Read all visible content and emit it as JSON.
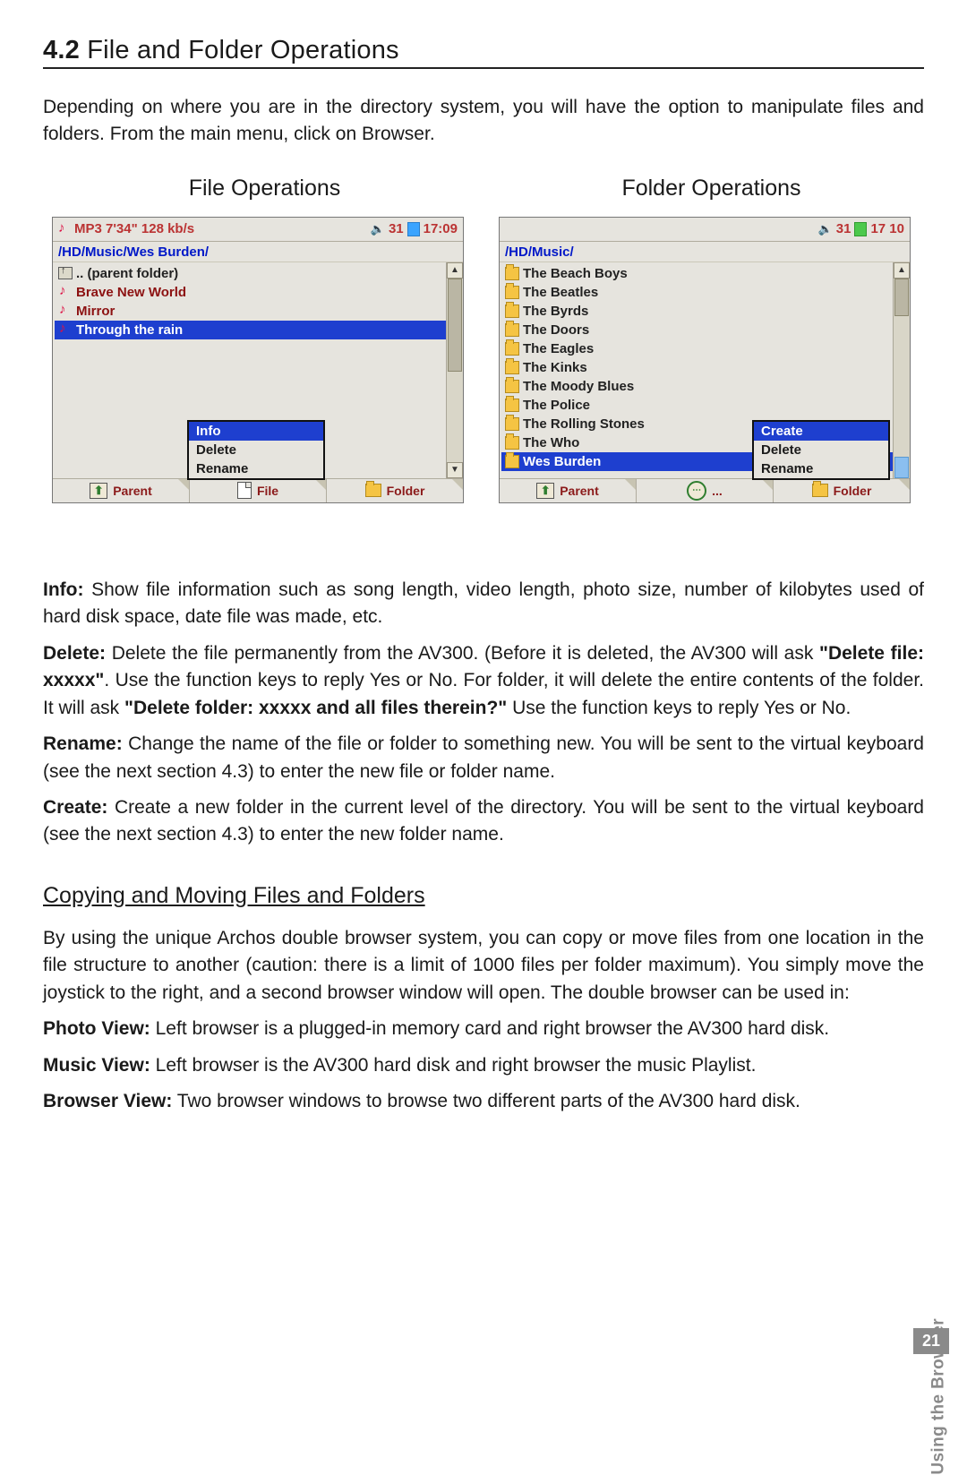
{
  "section_number": "4.2",
  "section_title": "File and Folder Operations",
  "intro": "Depending on where you are in the directory system, you will have the option to manipulate files and folders. From the main menu, click on Browser.",
  "file_ops_heading": "File Operations",
  "folder_ops_heading": "Folder Operations",
  "file_screen": {
    "status_mp3": "MP3 7'34\" 128 kb/s",
    "status_batt": "31",
    "status_time": "17:09",
    "path": "/HD/Music/Wes Burden/",
    "rows": [
      {
        "icon": "parent",
        "label": ".. (parent folder)",
        "style": "normal"
      },
      {
        "icon": "note",
        "label": "Brave New World",
        "style": "songred"
      },
      {
        "icon": "note",
        "label": "Mirror",
        "style": "songred"
      },
      {
        "icon": "note",
        "label": "Through the rain",
        "style": "highlight"
      }
    ],
    "menu": [
      "Info",
      "Delete",
      "Rename"
    ],
    "menu_highlight_index": 0,
    "bottom": [
      "Parent",
      "File",
      "Folder"
    ]
  },
  "folder_screen": {
    "status_batt": "31",
    "status_time": "17 10",
    "path": "/HD/Music/",
    "rows": [
      "The Beach Boys",
      "The Beatles",
      "The Byrds",
      "The Doors",
      "The Eagles",
      "The Kinks",
      "The Moody Blues",
      "The Police",
      "The Rolling Stones",
      "The Who",
      "Wes Burden"
    ],
    "rows_highlight_index": 10,
    "menu": [
      "Create",
      "Delete",
      "Rename"
    ],
    "menu_highlight_index": 0,
    "bottom": [
      "Parent",
      "...",
      "Folder"
    ]
  },
  "defs": {
    "info_label": "Info:",
    "info_text": " Show file information such as song length, video length, photo size, number of kilobytes used of hard disk space, date file was made, etc.",
    "delete_label": "Delete:",
    "delete_text_a": " Delete the file permanently from the AV300. (Before it is deleted, the AV300 will ask ",
    "delete_bold_a": "\"Delete file: xxxxx\"",
    "delete_text_b": ". Use the function keys to reply Yes or No. For folder, it will delete the entire contents of the folder. It will ask ",
    "delete_bold_b": "\"Delete folder: xxxxx and all files therein?\"",
    "delete_text_c": " Use the function keys to reply Yes or No.",
    "rename_label": "Rename:",
    "rename_text": " Change the name of the file or folder to something new. You will be sent to the virtual keyboard (see the next section 4.3) to enter the new file or folder name.",
    "create_label": "Create:",
    "create_text": " Create a new folder in the current level of the directory. You will be sent to the virtual keyboard (see the next section 4.3) to enter the new folder name."
  },
  "copy_heading": "Copying and Moving Files and Folders",
  "copy_intro": "By using the unique Archos double browser system, you can copy or move files from one location in the file structure to another (caution: there is a limit of 1000 files per folder maximum). You simply move the joystick to the right, and a second browser window will open. The double browser can be used in:",
  "views": {
    "photo_label": "Photo View:",
    "photo_text": " Left browser is a plugged-in memory card and right browser the AV300 hard disk.",
    "music_label": "Music View:",
    "music_text": " Left browser is the AV300 hard disk and right browser the music Playlist.",
    "browser_label": "Browser View:",
    "browser_text": " Two browser windows to browse two different parts of the AV300 hard disk."
  },
  "side_tab": "Using the Browser",
  "page_number": "21"
}
